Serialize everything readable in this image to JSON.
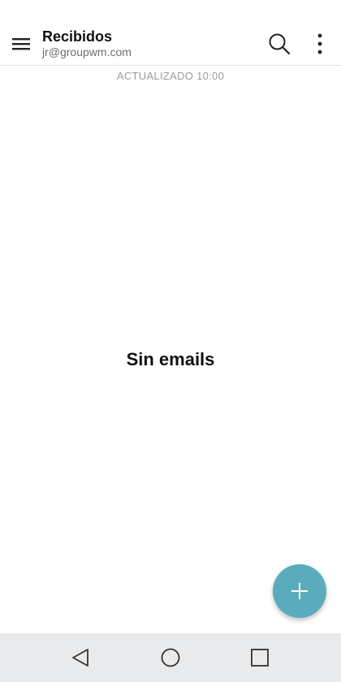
{
  "app_bar": {
    "title": "Recibidos",
    "account": "jr@groupwm.com",
    "icons": {
      "menu": "hamburger-menu-icon",
      "search": "search-icon",
      "overflow": "more-vertical-icon"
    }
  },
  "status": {
    "updated_text": "ACTUALIZADO 10:00"
  },
  "empty_state": {
    "message": "Sin emails"
  },
  "fab": {
    "icon": "plus-icon",
    "color": "#5aacbd"
  },
  "nav_bar": {
    "icons": [
      "back-triangle-icon",
      "home-circle-icon",
      "recent-apps-square-icon"
    ]
  }
}
